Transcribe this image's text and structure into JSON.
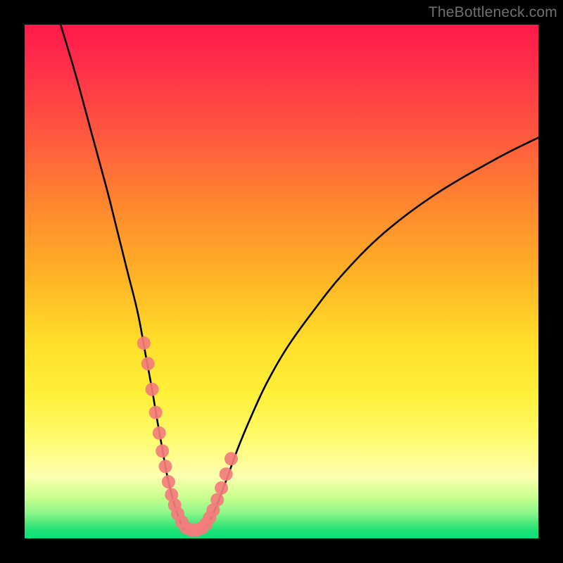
{
  "watermark": "TheBottleneck.com",
  "chart_data": {
    "type": "line",
    "title": "",
    "xlabel": "",
    "ylabel": "",
    "xlim": [
      0,
      100
    ],
    "ylim": [
      0,
      100
    ],
    "grid": false,
    "legend": false,
    "series": [
      {
        "name": "left-curve",
        "x": [
          7,
          10,
          13,
          16,
          18,
          20,
          22,
          23.5,
          24.8,
          25.8,
          26.7,
          27.4,
          28.0,
          28.5,
          29.0,
          29.5,
          30.0,
          30.5,
          31.0
        ],
        "values": [
          100,
          90,
          79,
          68,
          60,
          52,
          44,
          36,
          29,
          23,
          18,
          14,
          11,
          9,
          7,
          5.5,
          4,
          2.8,
          1.8
        ]
      },
      {
        "name": "right-curve",
        "x": [
          35.0,
          35.8,
          36.8,
          38.0,
          39.5,
          41.5,
          44.0,
          47.0,
          51.0,
          56.0,
          62.0,
          70.0,
          80.0,
          92.0,
          100.0
        ],
        "values": [
          1.8,
          3.0,
          5.0,
          8.0,
          12.0,
          17.5,
          23.5,
          30.0,
          37.0,
          44.0,
          51.5,
          59.5,
          67.0,
          74.0,
          78.0
        ]
      },
      {
        "name": "valley-flat",
        "x": [
          31.0,
          32.0,
          33.0,
          34.0,
          35.0
        ],
        "values": [
          1.8,
          1.5,
          1.5,
          1.5,
          1.8
        ]
      }
    ],
    "scatter_points": {
      "name": "highlight-dots",
      "color": "#f47c7c",
      "x": [
        23.2,
        24.0,
        24.8,
        25.5,
        26.2,
        26.8,
        27.4,
        28.0,
        28.6,
        29.2,
        29.8,
        30.6,
        31.5,
        32.5,
        33.5,
        34.5,
        35.3,
        36.0,
        36.7,
        37.5,
        38.3,
        39.2,
        40.2
      ],
      "y": [
        38.0,
        34.0,
        29.0,
        24.5,
        20.5,
        17.0,
        14.0,
        11.0,
        8.5,
        6.5,
        4.8,
        3.2,
        2.0,
        1.6,
        1.6,
        2.0,
        2.8,
        4.0,
        5.5,
        7.5,
        9.8,
        12.5,
        15.5
      ]
    },
    "background_gradient": {
      "orientation": "vertical",
      "stops": [
        {
          "pos": 0.0,
          "color": "#ff1a4a"
        },
        {
          "pos": 0.22,
          "color": "#ff5a3e"
        },
        {
          "pos": 0.5,
          "color": "#ffdf2a"
        },
        {
          "pos": 0.8,
          "color": "#fffb6a"
        },
        {
          "pos": 0.95,
          "color": "#8ef78a"
        },
        {
          "pos": 1.0,
          "color": "#0ae07a"
        }
      ]
    }
  }
}
